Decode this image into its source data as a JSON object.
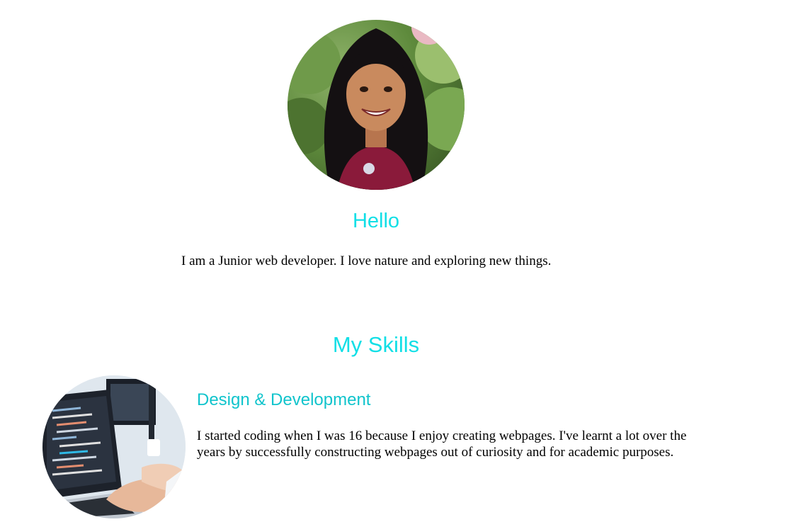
{
  "profile": {
    "photo_icon": "portrait-photo",
    "heading": "Hello",
    "intro": "I am a Junior web developer. I love nature and exploring new things."
  },
  "skills": {
    "heading": "My Skills",
    "items": [
      {
        "photo_icon": "laptop-coding-photo",
        "title": "Design & Development",
        "description": "I started coding when I was 16 because I enjoy creating webpages. I've learnt a lot over the years by successfully constructing webpages out of curiosity and for academic purposes."
      }
    ]
  },
  "colors": {
    "accent": "#11dfe6",
    "subheading": "#11c4cc",
    "text": "#000000",
    "background": "#ffffff"
  }
}
